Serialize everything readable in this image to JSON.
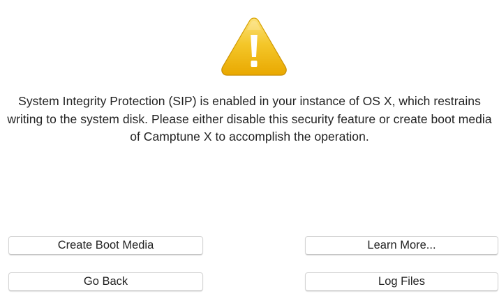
{
  "dialog": {
    "icon": "warning-icon",
    "message": "System Integrity Protection (SIP) is enabled in your instance of OS X, which restrains writing to the system disk. Please either disable this security feature or create boot media of Camptune X to accomplish the operation.",
    "buttons": {
      "create_boot_media": "Create Boot Media",
      "learn_more": "Learn More...",
      "go_back": "Go Back",
      "log_files": "Log Files"
    }
  },
  "colors": {
    "warning_yellow": "#f2c200",
    "warning_orange": "#e9a400",
    "text": "#222222"
  }
}
